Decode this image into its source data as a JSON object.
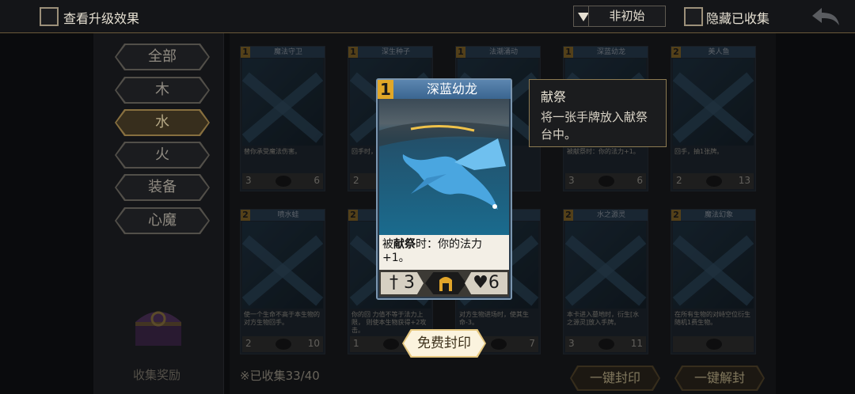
{
  "topbar": {
    "upgrade_label": "查看升级效果",
    "filter_label": "非初始",
    "hide_collected_label": "隐藏已收集"
  },
  "sidebar": {
    "items": [
      {
        "label": "全部",
        "active": false
      },
      {
        "label": "木",
        "active": false
      },
      {
        "label": "水",
        "active": true
      },
      {
        "label": "火",
        "active": false
      },
      {
        "label": "装备",
        "active": false
      },
      {
        "label": "心魔",
        "active": false
      }
    ],
    "reward_label": "收集奖励"
  },
  "cards": [
    {
      "cost": "1",
      "name": "魔法守卫",
      "text": "替你承受魔法伤害。",
      "atk": "3",
      "hp": "6"
    },
    {
      "cost": "1",
      "name": "深生种子",
      "text": "回手时， 洗入对",
      "atk": "2",
      "hp": ""
    },
    {
      "cost": "1",
      "name": "法潮涌动",
      "text": "",
      "atk": "",
      "hp": ""
    },
    {
      "cost": "1",
      "name": "深蓝幼龙",
      "text": "被献祭时：你的法力+1。",
      "atk": "3",
      "hp": "6"
    },
    {
      "cost": "2",
      "name": "美人鱼",
      "text": "回手，抽1张牌。",
      "atk": "2",
      "hp": "13"
    },
    {
      "cost": "2",
      "name": "喷水蛙",
      "text": "使一个生命不高于本生物的对方生物回手。",
      "atk": "2",
      "hp": "10"
    },
    {
      "cost": "2",
      "name": "",
      "text": "你的回 力值不等于法力上限， 则使本生物获得+2攻击。",
      "atk": "1",
      "hp": ""
    },
    {
      "cost": "",
      "name": "",
      "text": "对方生物进场时，使其生命-3。",
      "atk": "",
      "hp": "7"
    },
    {
      "cost": "2",
      "name": "水之源灵",
      "text": "本卡进入墓地时，衍生[水之源灵]放入手牌。",
      "atk": "3",
      "hp": "11"
    },
    {
      "cost": "2",
      "name": "魔法幻象",
      "text": "在所有生物的对峙空位衍生随机1费生物。",
      "atk": "",
      "hp": ""
    }
  ],
  "collected_label": "※已收集33/40",
  "buttons": {
    "seal_all": "一键封印",
    "unseal_all": "一键解封",
    "free_seal": "免费封印"
  },
  "focused_card": {
    "cost": "1",
    "name": "深蓝幼龙",
    "text_prefix": "被",
    "text_keyword": "献祭",
    "text_suffix": "时：你的法力+1。",
    "atk": "3",
    "hp": "6",
    "atk_icon": "dagger-icon",
    "hp_icon": "heart-icon",
    "type_icon": "helmet-icon"
  },
  "tooltip": {
    "title": "献祭",
    "desc": "将一张手牌放入献祭台中。"
  },
  "colors": {
    "accent_gold": "#b59554",
    "card_header_blue": "#5c86b0",
    "cost_orange": "#e1a728"
  }
}
